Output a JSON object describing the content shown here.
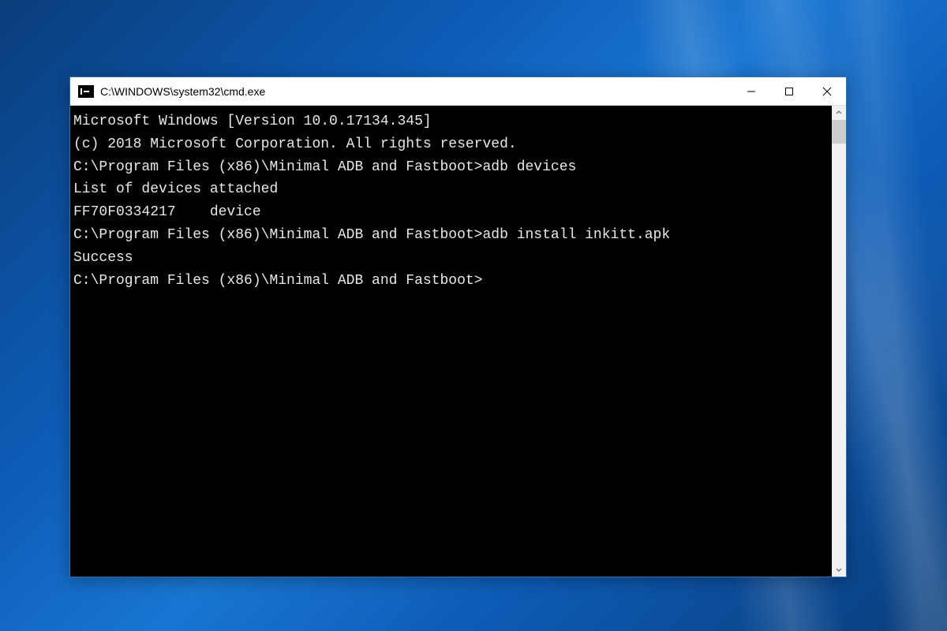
{
  "window": {
    "title": "C:\\WINDOWS\\system32\\cmd.exe"
  },
  "terminal": {
    "lines": {
      "l0": "Microsoft Windows [Version 10.0.17134.345]",
      "l1": "(c) 2018 Microsoft Corporation. All rights reserved.",
      "l2": "",
      "l3": "C:\\Program Files (x86)\\Minimal ADB and Fastboot>adb devices",
      "l4": "List of devices attached",
      "l5": "FF70F0334217    device",
      "l6": "",
      "l7": "C:\\Program Files (x86)\\Minimal ADB and Fastboot>adb install inkitt.apk",
      "l8": "Success",
      "l9": "",
      "l10": "C:\\Program Files (x86)\\Minimal ADB and Fastboot>"
    }
  }
}
